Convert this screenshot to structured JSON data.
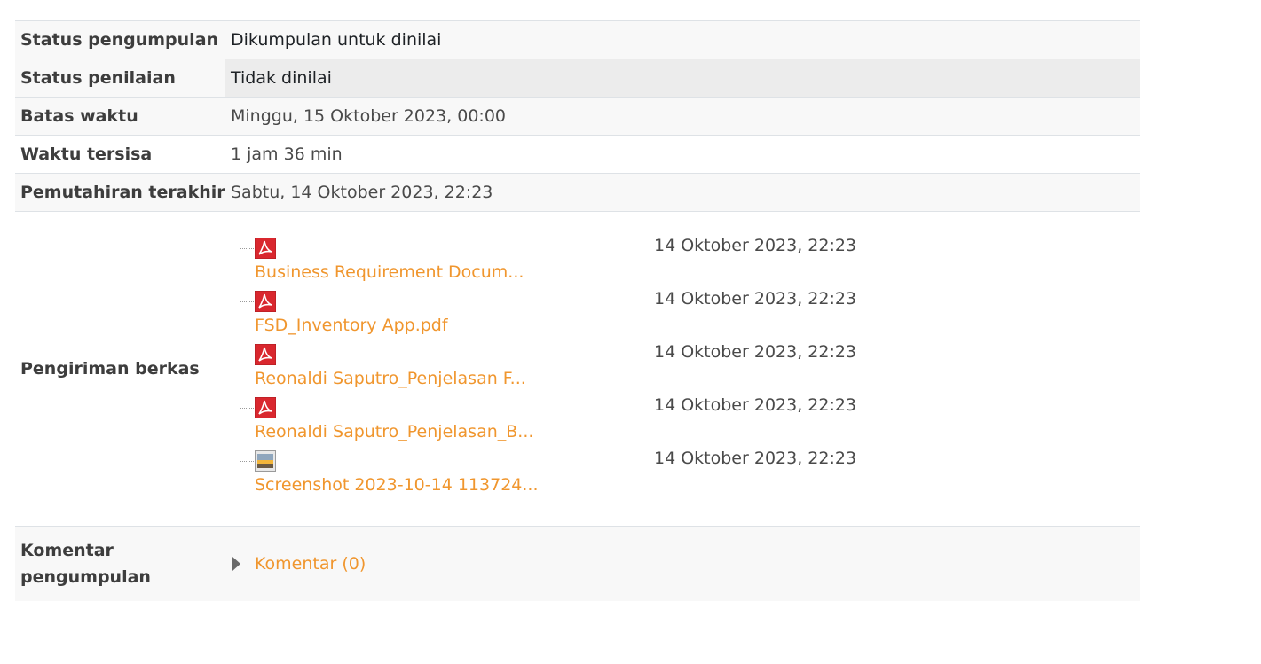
{
  "submission": {
    "rows": [
      {
        "label": "Status pengumpulan",
        "value": "Dikumpulan untuk dinilai"
      },
      {
        "label": "Status penilaian",
        "value": "Tidak dinilai"
      },
      {
        "label": "Batas waktu",
        "value": "Minggu, 15 Oktober 2023, 00:00"
      },
      {
        "label": "Waktu tersisa",
        "value": "1 jam 36 min"
      },
      {
        "label": "Pemutahiran terakhir",
        "value": "Sabtu, 14 Oktober 2023, 22:23"
      }
    ],
    "files_label": "Pengiriman berkas",
    "files": [
      {
        "name": "Business Requirement Docum...",
        "date": "14 Oktober 2023, 22:23",
        "icon": "pdf-icon"
      },
      {
        "name": "FSD_Inventory App.pdf",
        "date": "14 Oktober 2023, 22:23",
        "icon": "pdf-icon"
      },
      {
        "name": "Reonaldi Saputro_Penjelasan F...",
        "date": "14 Oktober 2023, 22:23",
        "icon": "pdf-icon"
      },
      {
        "name": "Reonaldi Saputro_Penjelasan_B...",
        "date": "14 Oktober 2023, 22:23",
        "icon": "pdf-icon"
      },
      {
        "name": "Screenshot 2023-10-14 113724...",
        "date": "14 Oktober 2023, 22:23",
        "icon": "image-icon"
      }
    ],
    "comments_label_line1": "Komentar",
    "comments_label_line2": "pengumpulan",
    "comments_link": "Komentar (0)"
  },
  "colors": {
    "link": "#f0962e",
    "pdf": "#d9272e",
    "row_alt": "#f8f8f8",
    "grey_cell": "#ececec"
  }
}
